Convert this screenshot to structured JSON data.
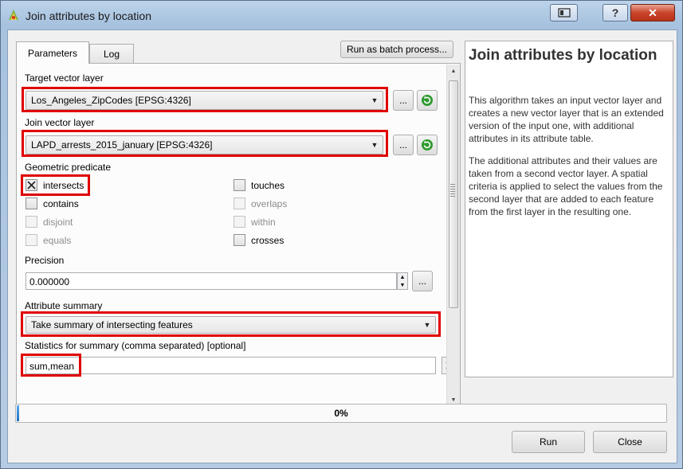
{
  "window": {
    "title": "Join attributes by location",
    "help_button": "?",
    "close_button": "✕"
  },
  "tabs": [
    {
      "label": "Parameters"
    },
    {
      "label": "Log"
    }
  ],
  "batch_button": "Run as batch process...",
  "params": {
    "target_label": "Target vector layer",
    "target_value": "Los_Angeles_ZipCodes [EPSG:4326]",
    "join_label": "Join vector layer",
    "join_value": "LAPD_arrests_2015_january [EPSG:4326]",
    "browse_label": "...",
    "predicate_label": "Geometric predicate",
    "predicates": [
      {
        "label": "intersects",
        "checked": true,
        "enabled": true
      },
      {
        "label": "contains",
        "checked": false,
        "enabled": true
      },
      {
        "label": "disjoint",
        "checked": false,
        "enabled": false
      },
      {
        "label": "equals",
        "checked": false,
        "enabled": false
      },
      {
        "label": "touches",
        "checked": false,
        "enabled": true
      },
      {
        "label": "overlaps",
        "checked": false,
        "enabled": false
      },
      {
        "label": "within",
        "checked": false,
        "enabled": false
      },
      {
        "label": "crosses",
        "checked": false,
        "enabled": true
      }
    ],
    "precision_label": "Precision",
    "precision_value": "0.000000",
    "summary_label": "Attribute summary",
    "summary_value": "Take summary of intersecting features",
    "stats_label": "Statistics for summary (comma separated) [optional]",
    "stats_value": "sum,mean"
  },
  "help": {
    "title": "Join attributes by location",
    "p1": "This algorithm takes an input vector layer and creates a new vector layer that is an extended version of the input one, with additional attributes in its attribute table.",
    "p2": "The additional attributes and their values are taken from a second vector layer. A spatial criteria is applied to select the values from the second layer that are added to each feature from the first layer in the resulting one."
  },
  "progress": {
    "label": "0%",
    "value": 0
  },
  "buttons": {
    "run": "Run",
    "close": "Close"
  },
  "colors": {
    "highlight": "#e00000",
    "refresh_icon": "#2e9a2e",
    "progress_fill": "#1e6fc0"
  }
}
